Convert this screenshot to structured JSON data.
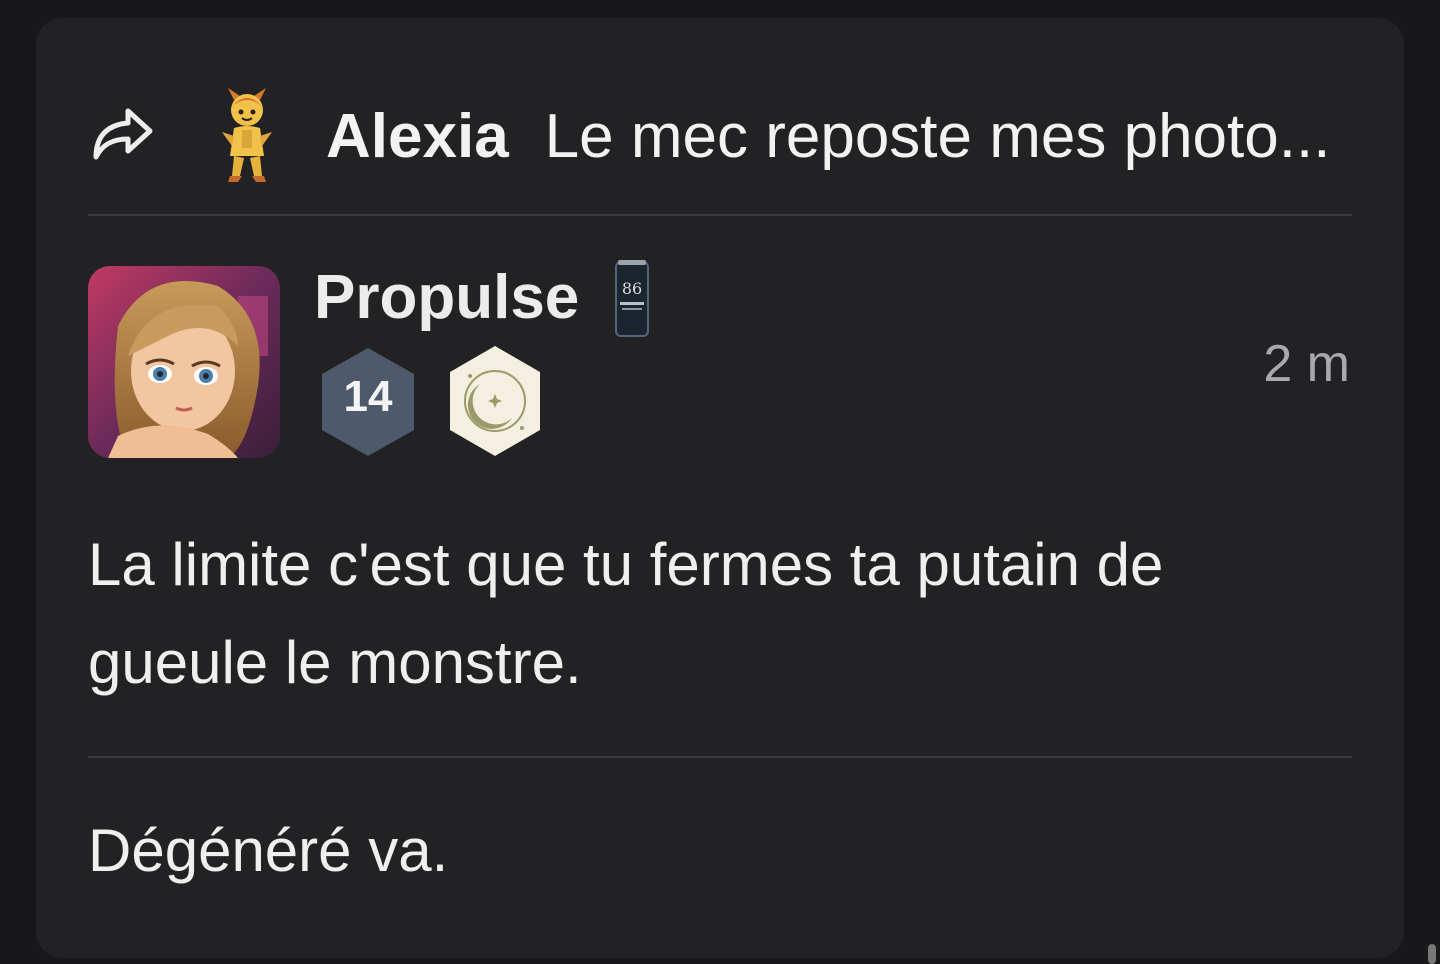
{
  "reply": {
    "icon": "share-reply-arrow-icon",
    "avatar_icon": "imp-character-avatar",
    "author": "Alexia",
    "snippet": "Le mec reposte mes photo..."
  },
  "post": {
    "avatar_icon": "illustrated-girl-avatar",
    "username": "Propulse",
    "username_badge_icon": "beer-can-86-icon",
    "level": "14",
    "moon_badge_icon": "moon-star-badge-icon",
    "time": "2 m",
    "message_lines": [
      "La limite c'est que tu fermes ta putain de",
      "gueule le monstre."
    ],
    "message_followup": "Dégénéré va."
  },
  "colors": {
    "page_bg": "#18181a",
    "card_bg": "#222224",
    "divider": "#3a3a3c",
    "text": "#efefef",
    "muted": "#a9a9ad",
    "level_badge": "#4e5a6c",
    "moon_badge_bg": "#f4efe0",
    "moon_badge_fg": "#9a9b6a"
  }
}
